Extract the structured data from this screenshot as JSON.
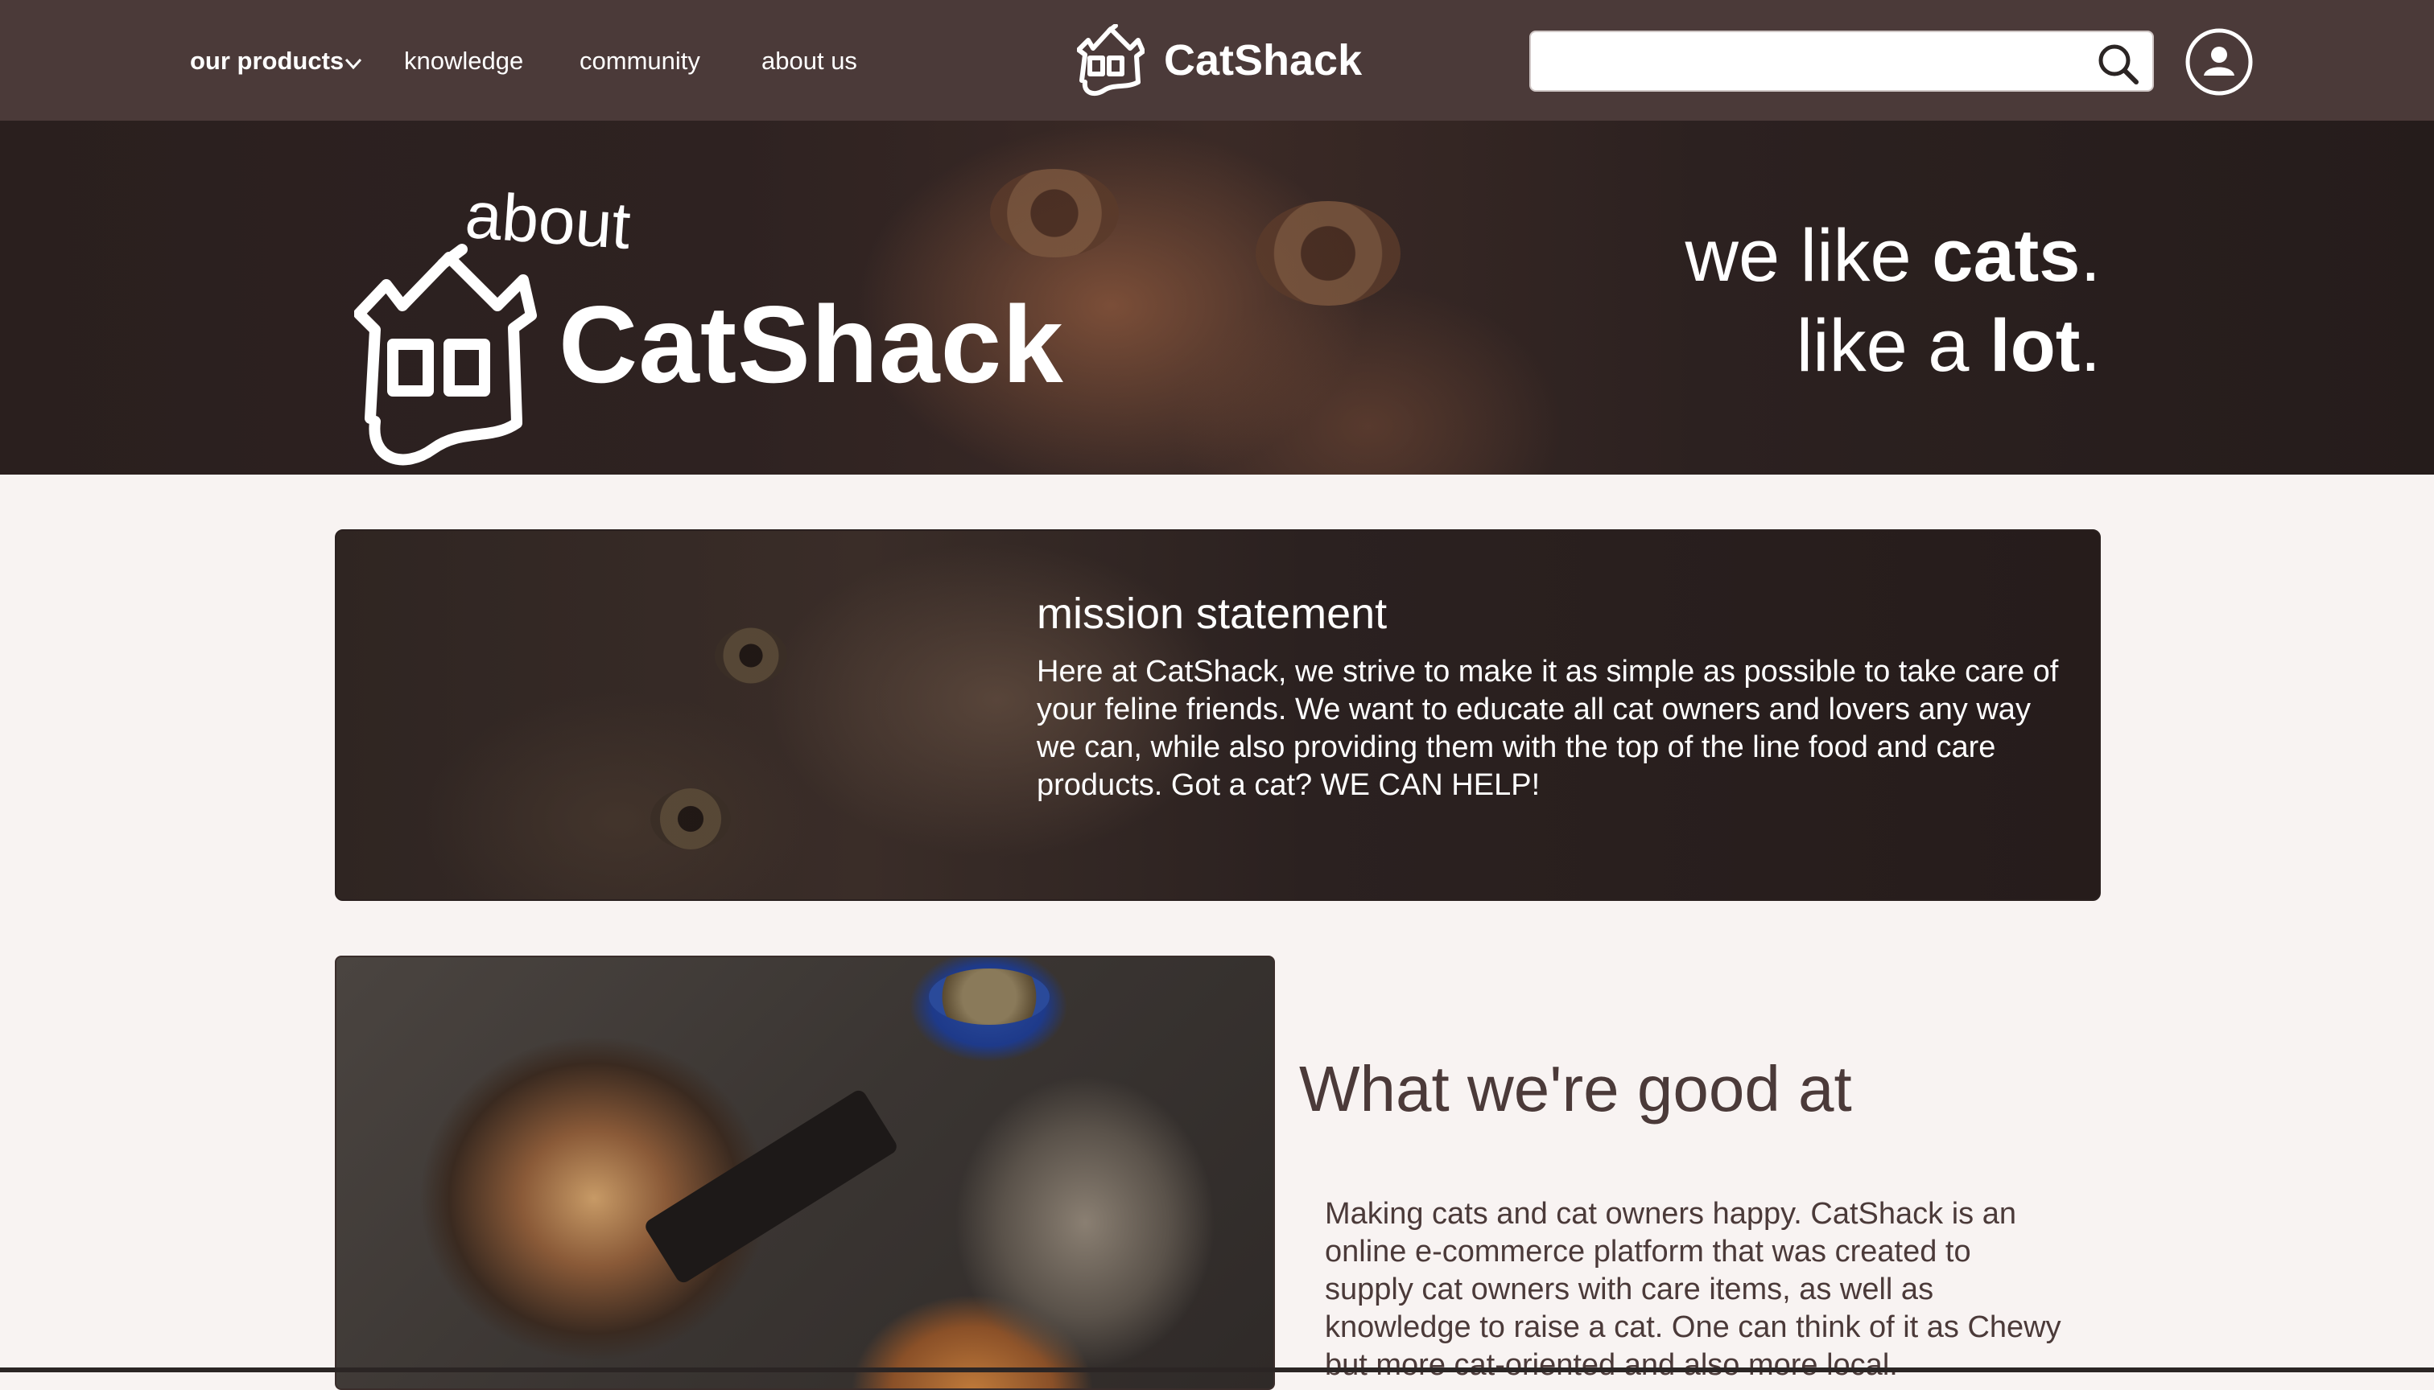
{
  "nav": {
    "items": [
      {
        "label": "our products"
      },
      {
        "label": "knowledge"
      },
      {
        "label": "community"
      },
      {
        "label": "about us"
      }
    ],
    "brand": "CatShack",
    "search_placeholder": "",
    "search_icon": "search-icon",
    "account_icon": "user-icon"
  },
  "hero": {
    "about": "about",
    "title": "CatShack",
    "tagline_line1_prefix": "we like ",
    "tagline_line1_bold": "cats",
    "tagline_line1_suffix": ".",
    "tagline_line2_prefix": "like a ",
    "tagline_line2_bold": "lot",
    "tagline_line2_suffix": "."
  },
  "mission": {
    "heading": "mission statement",
    "body": "Here at CatShack, we strive to make it as simple as possible to take care of your feline friends. We want to educate all cat owners and lovers any way we can, while also providing them with the top of the line food and care products. Got a cat? WE CAN HELP!"
  },
  "good": {
    "heading": "What we're good at",
    "body": "Making cats and cat owners happy. CatShack is an online e-commerce platform that was created to supply cat owners with care items, as well as knowledge to raise a cat. One can think of it as Chewy but more cat-oriented and also more local."
  },
  "colors": {
    "nav_bg": "#4b3a39",
    "page_bg": "#f8f3f2",
    "text_dark": "#4b3a39",
    "white": "#ffffff"
  }
}
